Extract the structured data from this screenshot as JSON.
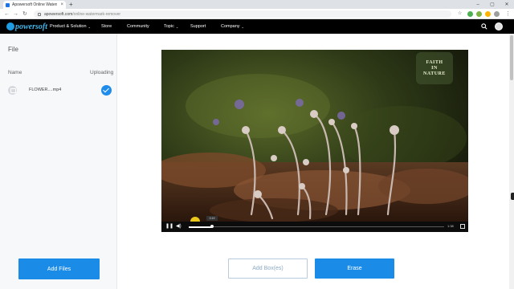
{
  "browser": {
    "tab_title": "Apowersoft Online Waterm...",
    "new_tab": "+",
    "url_host": "apowersoft.com",
    "url_path": "/online-watermark-remover",
    "win_min": "–",
    "win_max": "▢",
    "win_close": "✕"
  },
  "site": {
    "logo_text": "powersoft",
    "nav": [
      "Product & Solution",
      "Store",
      "Community",
      "Topic",
      "Support",
      "Company"
    ],
    "nav_has_caret": [
      true,
      false,
      false,
      true,
      false,
      true
    ]
  },
  "sidebar": {
    "title": "File",
    "col_name": "Name",
    "col_status": "Uploading",
    "files": [
      {
        "name": "FLOWER....mp4",
        "status": "done"
      }
    ],
    "add_files_label": "Add Files"
  },
  "player": {
    "watermark_lines": [
      "FAITH",
      "IN",
      "NATURE"
    ],
    "progress": 0.09,
    "hover_time": "0:19",
    "duration": "1:38"
  },
  "actions": {
    "add_box_label": "Add Box(es)",
    "erase_label": "Erase"
  },
  "colors": {
    "accent": "#1a8ce8",
    "nav_bg": "#000000",
    "cursor": "#f7d21c"
  }
}
